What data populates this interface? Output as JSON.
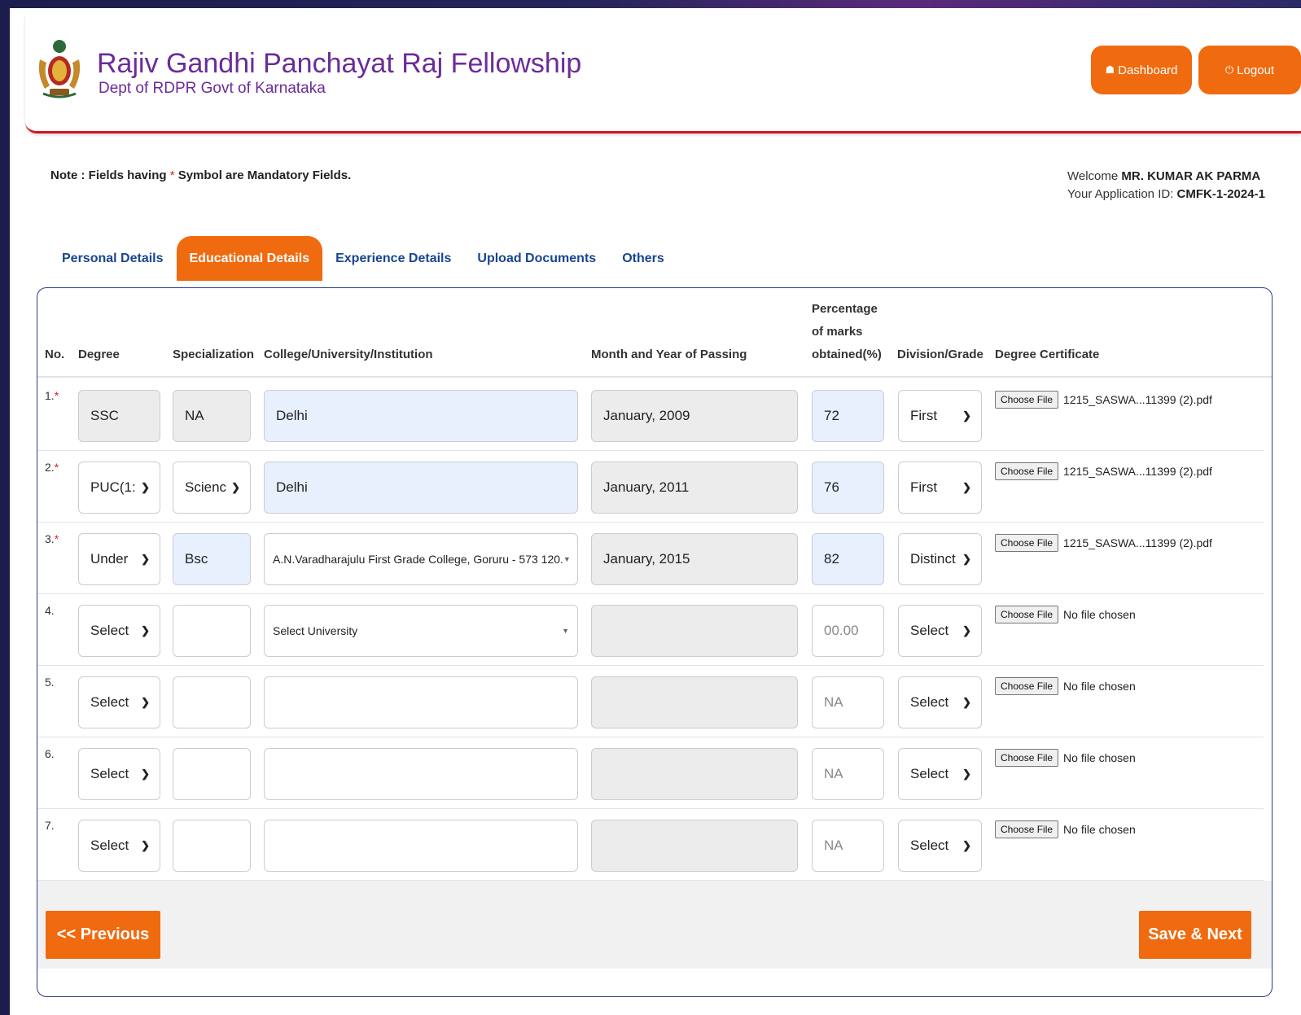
{
  "header": {
    "title": "Rajiv Gandhi Panchayat Raj Fellowship",
    "subtitle": "Dept of RDPR Govt of Karnataka",
    "dashboard_label": "Dashboard",
    "dashboard_icon": "home-icon",
    "logout_label": "Logout",
    "logout_icon": "power-icon"
  },
  "note": {
    "prefix": "Note : Fields having",
    "star": "*",
    "suffix": "Symbol are Mandatory Fields."
  },
  "welcome": {
    "welcome_label": "Welcome",
    "user_name": "MR. KUMAR AK PARMA",
    "app_id_label": "Your Application ID:",
    "app_id": "CMFK-1-2024-1"
  },
  "tabs": [
    {
      "label": "Personal Details"
    },
    {
      "label": "Educational Details"
    },
    {
      "label": "Experience Details"
    },
    {
      "label": "Upload Documents"
    },
    {
      "label": "Others"
    }
  ],
  "table": {
    "headers": {
      "no": "No.",
      "degree": "Degree",
      "specialization": "Specialization",
      "college": "College/University/Institution",
      "month_year": "Month and Year of Passing",
      "percentage_1": "Percentage",
      "percentage_2": "of marks",
      "percentage_3": "obtained(%)",
      "division": "Division/Grade",
      "certificate": "Degree Certificate"
    },
    "rows": [
      {
        "no": "1.",
        "req": "*",
        "degree": "SSC",
        "specialization": "NA",
        "college": "Delhi",
        "month_year": "January, 2009",
        "percentage": "72",
        "division": "First",
        "choose_file": "Choose File",
        "file_name": "1215_SASWA...11399 (2).pdf"
      },
      {
        "no": "2.",
        "req": "*",
        "degree": "PUC(1:",
        "specialization": "Scienc",
        "college": "Delhi",
        "month_year": "January, 2011",
        "percentage": "76",
        "division": "First",
        "choose_file": "Choose File",
        "file_name": "1215_SASWA...11399 (2).pdf"
      },
      {
        "no": "3.",
        "req": "*",
        "degree": "Under",
        "specialization": "Bsc",
        "college": "A.N.Varadharajulu First Grade College, Goruru - 573 120.",
        "month_year": "January, 2015",
        "percentage": "82",
        "division": "Distinct",
        "choose_file": "Choose File",
        "file_name": "1215_SASWA...11399 (2).pdf"
      },
      {
        "no": "4.",
        "req": "",
        "degree": "Select",
        "specialization": "",
        "college": "Select University",
        "month_year": "",
        "percentage": "00.00",
        "division": "Select",
        "choose_file": "Choose File",
        "file_name": "No file chosen"
      },
      {
        "no": "5.",
        "req": "",
        "degree": "Select",
        "specialization": "",
        "college": "",
        "month_year": "",
        "percentage": "NA",
        "division": "Select",
        "choose_file": "Choose File",
        "file_name": "No file chosen"
      },
      {
        "no": "6.",
        "req": "",
        "degree": "Select",
        "specialization": "",
        "college": "",
        "month_year": "",
        "percentage": "NA",
        "division": "Select",
        "choose_file": "Choose File",
        "file_name": "No file chosen"
      },
      {
        "no": "7.",
        "req": "",
        "degree": "Select",
        "specialization": "",
        "college": "",
        "month_year": "",
        "percentage": "NA",
        "division": "Select",
        "choose_file": "Choose File",
        "file_name": "No file chosen"
      }
    ]
  },
  "buttons": {
    "previous": "<< Previous",
    "save_next": "Save & Next"
  },
  "colors": {
    "accent_orange": "#f06a0f",
    "title_purple": "#6b2c9a",
    "tab_blue": "#18468f",
    "header_rule_red": "#d0161e",
    "required_red": "#e0202a",
    "frame_navy": "#1c1c4f"
  }
}
